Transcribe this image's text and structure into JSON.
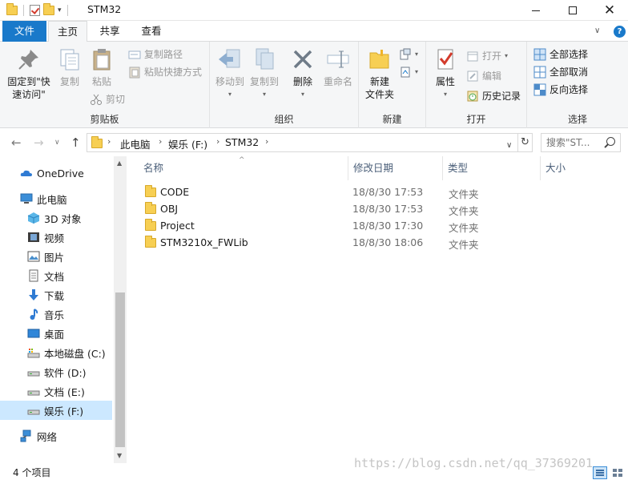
{
  "window": {
    "title": "STM32"
  },
  "ribbon_tabs": {
    "file": "文件",
    "home": "主页",
    "share": "共享",
    "view": "查看"
  },
  "ribbon": {
    "clipboard": {
      "label": "剪贴板",
      "pin_line1": "固定到\"快",
      "pin_line2": "速访问\"",
      "copy": "复制",
      "paste": "粘贴",
      "copy_path": "复制路径",
      "paste_shortcut": "粘贴快捷方式",
      "cut": "剪切"
    },
    "organize": {
      "label": "组织",
      "move_to": "移动到",
      "copy_to": "复制到",
      "delete": "删除",
      "rename": "重命名"
    },
    "new": {
      "label": "新建",
      "new_folder_line1": "新建",
      "new_folder_line2": "文件夹"
    },
    "open": {
      "label": "打开",
      "properties": "属性",
      "open": "打开",
      "edit": "编辑",
      "history": "历史记录"
    },
    "select": {
      "label": "选择",
      "select_all": "全部选择",
      "select_none": "全部取消",
      "invert": "反向选择"
    }
  },
  "address": {
    "crumbs": [
      "此电脑",
      "娱乐 (F:)",
      "STM32"
    ],
    "search_placeholder": "搜索\"ST..."
  },
  "nav": {
    "onedrive": "OneDrive",
    "this_pc": "此电脑",
    "objects3d": "3D 对象",
    "videos": "视频",
    "pictures": "图片",
    "documents": "文档",
    "downloads": "下载",
    "music": "音乐",
    "desktop": "桌面",
    "drive_c": "本地磁盘 (C:)",
    "drive_d": "软件 (D:)",
    "drive_e": "文档 (E:)",
    "drive_f": "娱乐 (F:)",
    "network": "网络"
  },
  "columns": {
    "name": "名称",
    "modified": "修改日期",
    "type": "类型",
    "size": "大小"
  },
  "files": [
    {
      "name": "CODE",
      "modified": "18/8/30 17:53",
      "type": "文件夹"
    },
    {
      "name": "OBJ",
      "modified": "18/8/30 17:53",
      "type": "文件夹"
    },
    {
      "name": "Project",
      "modified": "18/8/30 17:30",
      "type": "文件夹"
    },
    {
      "name": "STM3210x_FWLib",
      "modified": "18/8/30 18:06",
      "type": "文件夹"
    }
  ],
  "status": {
    "item_count": "4 个项目"
  },
  "watermark": "https://blog.csdn.net/qq_37369201",
  "colors": {
    "accent": "#1979ca",
    "selection": "#cce8ff",
    "folder": "#f7cf53"
  }
}
